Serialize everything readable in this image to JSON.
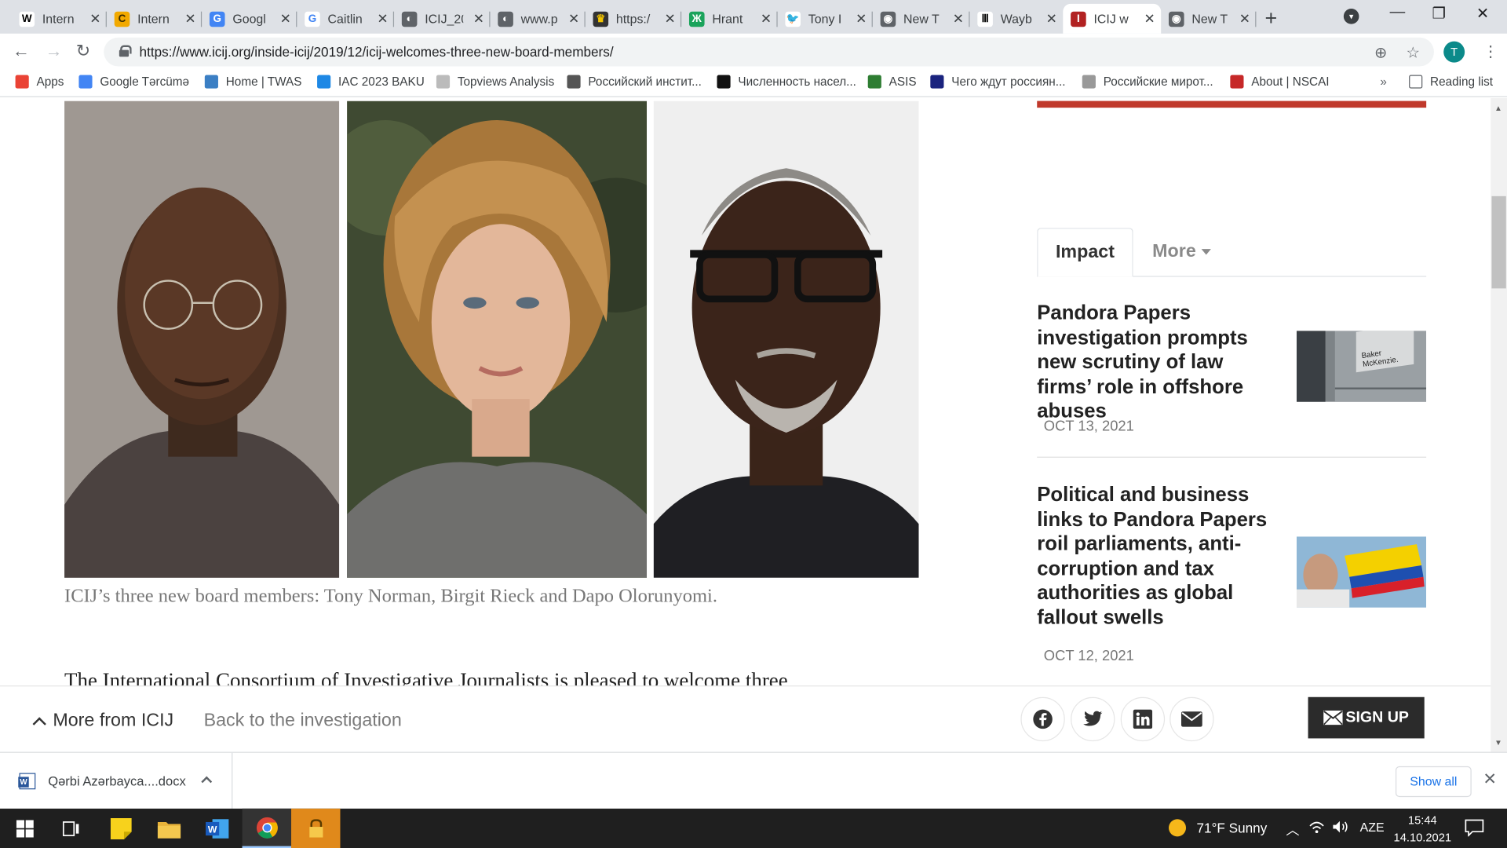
{
  "browser": {
    "tabs": [
      {
        "title": "Intern",
        "icon": "wikipedia-icon",
        "color": "#ffffff",
        "glyph": "W",
        "glyph_color": "#000000"
      },
      {
        "title": "Intern",
        "icon": "crossref-icon",
        "color": "#f2a900",
        "glyph": "C",
        "glyph_color": "#3a2a00"
      },
      {
        "title": "Googl",
        "icon": "google-translate-icon",
        "color": "#4285f4",
        "glyph": "G",
        "glyph_color": "#ffffff"
      },
      {
        "title": "Caitlin",
        "icon": "google-icon",
        "color": "#ffffff",
        "glyph": "G",
        "glyph_color": "#4285f4"
      },
      {
        "title": "ICIJ_20",
        "icon": "globe-icon",
        "color": "#5f6368",
        "glyph": "◐",
        "glyph_color": "#ffffff"
      },
      {
        "title": "www.p",
        "icon": "globe-icon",
        "color": "#5f6368",
        "glyph": "◐",
        "glyph_color": "#ffffff"
      },
      {
        "title": "https:/",
        "icon": "site-icon",
        "color": "#333333",
        "glyph": "♛",
        "glyph_color": "#f2c400"
      },
      {
        "title": "Hrant",
        "icon": "hrant-icon",
        "color": "#1aa35b",
        "glyph": "Ж",
        "glyph_color": "#ffffff"
      },
      {
        "title": "Tony I",
        "icon": "twitter-icon",
        "color": "#ffffff",
        "glyph": "🐦",
        "glyph_color": "#1da1f2"
      },
      {
        "title": "New T",
        "icon": "chrome-icon",
        "color": "#5f6368",
        "glyph": "◉",
        "glyph_color": "#ffffff"
      },
      {
        "title": "Wayb",
        "icon": "wayback-icon",
        "color": "#ffffff",
        "glyph": "Ⅲ",
        "glyph_color": "#000000"
      },
      {
        "title": "ICIJ w",
        "icon": "icij-icon",
        "color": "#b22222",
        "glyph": "I",
        "glyph_color": "#ffffff",
        "active": true
      },
      {
        "title": "New T",
        "icon": "chrome-icon",
        "color": "#5f6368",
        "glyph": "◉",
        "glyph_color": "#ffffff"
      }
    ],
    "url": "https://www.icij.org/inside-icij/2019/12/icij-welcomes-three-new-board-members/",
    "profile_initial": "T",
    "bookmarks": [
      {
        "label": "Apps",
        "color": "#ea4335"
      },
      {
        "label": "Google Tərcümə",
        "color": "#4285f4"
      },
      {
        "label": "Home | TWAS",
        "color": "#3b7fc4"
      },
      {
        "label": "IAC 2023 BAKU",
        "color": "#1e88e5"
      },
      {
        "label": "Topviews Analysis",
        "color": "#bbbbbb"
      },
      {
        "label": "Российский инстит...",
        "color": "#555555"
      },
      {
        "label": "Численность насел...",
        "color": "#111111"
      },
      {
        "label": "ASIS",
        "color": "#2e7d32"
      },
      {
        "label": "Чего ждут россиян...",
        "color": "#1a237e"
      },
      {
        "label": "Российские мирот...",
        "color": "#999999"
      },
      {
        "label": "About | NSCAI",
        "color": "#c62828"
      }
    ],
    "bookmarks_overflow": "»",
    "reading_list": "Reading list"
  },
  "article": {
    "caption": "ICIJ’s three new board members: Tony Norman, Birgit Rieck and Dapo Olorunyomi.",
    "body_start": "The International Consortium of Investigative Journalists is pleased to welcome three"
  },
  "sidebar": {
    "tabs": {
      "impact": "Impact",
      "more": "More"
    },
    "stories": [
      {
        "title": "Pandora Papers investigation prompts new scrutiny of law firms’ role in offshore abuses",
        "date": "OCT 13, 2021"
      },
      {
        "title": "Political and business links to Pandora Papers roil parliaments, anti-corruption and tax authorities as global fallout swells",
        "date": "OCT 12, 2021"
      }
    ],
    "thumb_sign": "Baker McKenzie."
  },
  "sticky": {
    "more": "More from ICIJ",
    "back": "Back to the investigation",
    "signup": "SIGN UP"
  },
  "downloads": {
    "file": "Qərbi Azərbayca....docx",
    "show_all": "Show all"
  },
  "taskbar": {
    "weather": "71°F  Sunny",
    "lang": "AZE",
    "time": "15:44",
    "date": "14.10.2021"
  }
}
